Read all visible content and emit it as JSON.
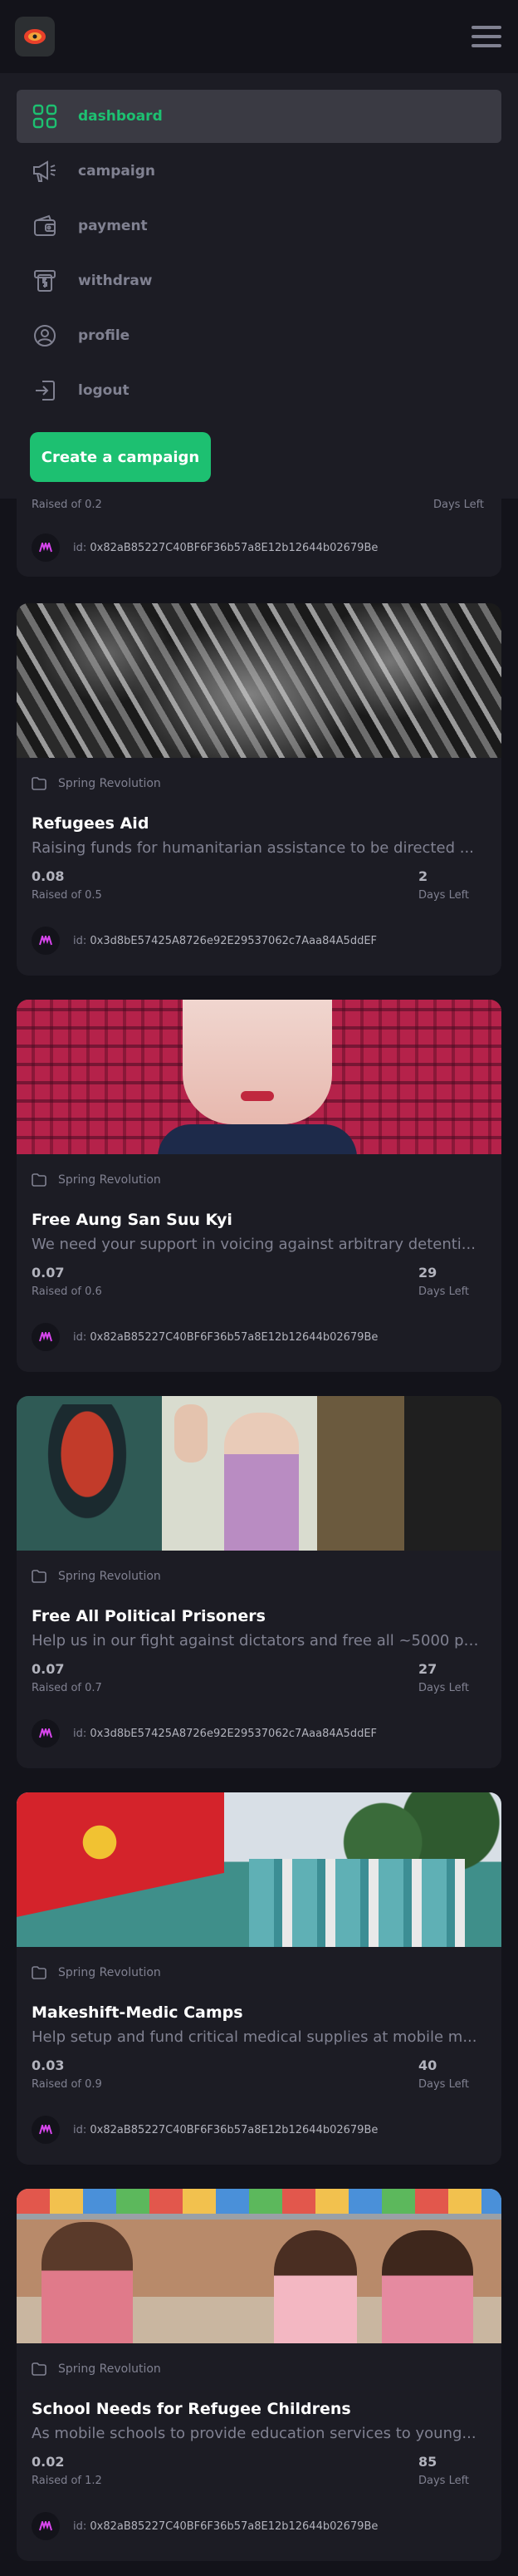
{
  "menu": {
    "items": [
      {
        "label": "dashboard",
        "icon": "dashboard-icon"
      },
      {
        "label": "campaign",
        "icon": "megaphone-icon"
      },
      {
        "label": "payment",
        "icon": "wallet-icon"
      },
      {
        "label": "withdraw",
        "icon": "withdraw-icon"
      },
      {
        "label": "profile",
        "icon": "user-icon"
      },
      {
        "label": "logout",
        "icon": "logout-icon"
      }
    ],
    "create_label": "Create a campaign"
  },
  "partial_card": {
    "raised": "Raised of 0.2",
    "days_label": "Days Left",
    "id_prefix": "id:",
    "owner": "0x82aB85227C40BF6F36b57a8E12b12644b02679Be"
  },
  "cards": [
    {
      "category": "Spring Revolution",
      "title": "Refugees Aid",
      "desc": "Raising funds for humanitarian assistance to be directed ...",
      "collected": "0.08",
      "raised": "Raised of 0.5",
      "days": "2",
      "days_label": "Days Left",
      "id_prefix": "id:",
      "owner": "0x3d8bE57425A8726e92E29537062c7Aaa84A5ddEF",
      "image": "crowd-photo"
    },
    {
      "category": "Spring Revolution",
      "title": "Free Aung San Suu Kyi",
      "desc": "We need your support in voicing against arbitrary detenti...",
      "collected": "0.07",
      "raised": "Raised of 0.6",
      "days": "29",
      "days_label": "Days Left",
      "id_prefix": "id:",
      "owner": "0x82aB85227C40BF6F36b57a8E12b12644b02679Be",
      "image": "portrait-photo"
    },
    {
      "category": "Spring Revolution",
      "title": "Free All Political Prisoners",
      "desc": "Help us in our fight against dictators and free all ~5000 pol...",
      "collected": "0.07",
      "raised": "Raised of 0.7",
      "days": "27",
      "days_label": "Days Left",
      "id_prefix": "id:",
      "owner": "0x3d8bE57425A8726e92E29537062c7Aaa84A5ddEF",
      "image": "protest-photo"
    },
    {
      "category": "Spring Revolution",
      "title": "Makeshift-Medic Camps",
      "desc": "Help setup and fund critical medical supplies at mobile m...",
      "collected": "0.03",
      "raised": "Raised of 0.9",
      "days": "40",
      "days_label": "Days Left",
      "id_prefix": "id:",
      "owner": "0x82aB85227C40BF6F36b57a8E12b12644b02679Be",
      "image": "medics-photo"
    },
    {
      "category": "Spring Revolution",
      "title": "School Needs for Refugee Childrens",
      "desc": "As mobile schools to provide education services to young...",
      "collected": "0.02",
      "raised": "Raised of 1.2",
      "days": "85",
      "days_label": "Days Left",
      "id_prefix": "id:",
      "owner": "0x82aB85227C40BF6F36b57a8E12b12644b02679Be",
      "image": "children-photo"
    }
  ]
}
